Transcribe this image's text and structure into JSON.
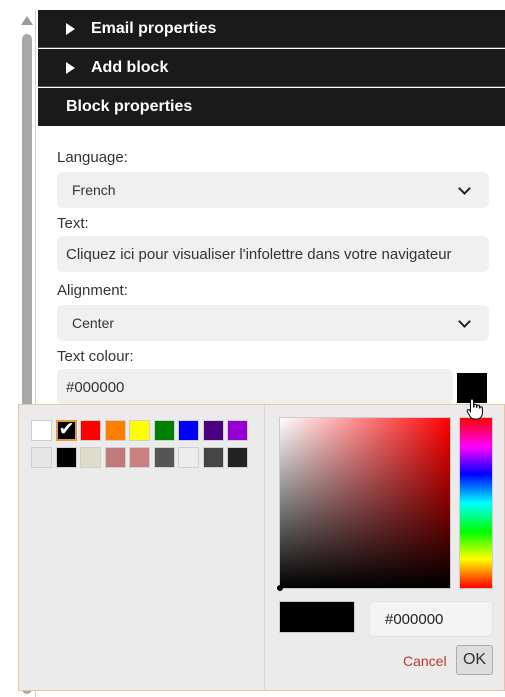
{
  "accordion": {
    "email_properties": "Email properties",
    "add_block": "Add block",
    "block_properties": "Block properties"
  },
  "form": {
    "language_label": "Language:",
    "language_value": "French",
    "text_label": "Text:",
    "text_value": "Cliquez ici pour visualiser l'infolettre dans votre navigateur",
    "alignment_label": "Alignment:",
    "alignment_value": "Center",
    "text_colour_label": "Text colour:",
    "text_colour_value": "#000000"
  },
  "color_picker": {
    "swatches": [
      "#ffffff",
      "#000000",
      "#ff0000",
      "#ff8000",
      "#ffff00",
      "#008000",
      "#0000ff",
      "#4b0082",
      "#9400d3",
      "#e6e6e6",
      "#000000",
      "#e0dccb",
      "#c17a7a",
      "#c98080",
      "#555555",
      "#ececec",
      "#444444",
      "#222222"
    ],
    "selected_swatch": 1,
    "hex_value": "#000000",
    "cancel_label": "Cancel",
    "ok_label": "OK"
  },
  "icons": {
    "chevron": "chevron-down-icon",
    "triangle": "triangle-right-icon",
    "cursor": "hand-pointer-icon"
  }
}
